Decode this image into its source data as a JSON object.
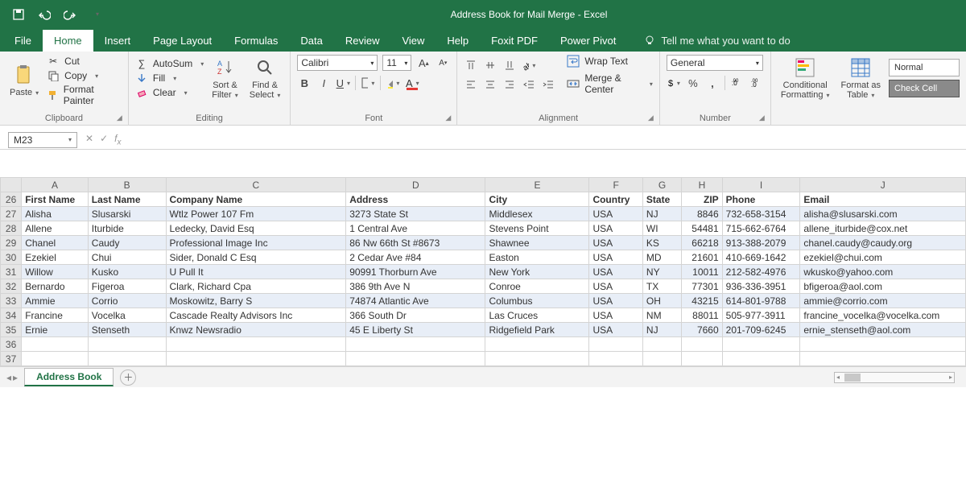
{
  "title": "Address Book for Mail Merge  -  Excel",
  "tabs": [
    "File",
    "Home",
    "Insert",
    "Page Layout",
    "Formulas",
    "Data",
    "Review",
    "View",
    "Help",
    "Foxit PDF",
    "Power Pivot"
  ],
  "tellme": "Tell me what you want to do",
  "clipboard": {
    "paste": "Paste",
    "cut": "Cut",
    "copy": "Copy",
    "fp": "Format Painter",
    "label": "Clipboard"
  },
  "editing": {
    "autosum": "AutoSum",
    "fill": "Fill",
    "clear": "Clear",
    "sort": "Sort &\nFilter",
    "find": "Find &\nSelect",
    "label": "Editing"
  },
  "font": {
    "name": "Calibri",
    "size": "11",
    "label": "Font"
  },
  "alignment": {
    "wrap": "Wrap Text",
    "merge": "Merge & Center",
    "label": "Alignment"
  },
  "number": {
    "fmt": "General",
    "label": "Number"
  },
  "styles": {
    "cf": "Conditional\nFormatting",
    "fat": "Format as\nTable",
    "normal": "Normal",
    "check": "Check Cell"
  },
  "namebox": "M23",
  "columns": [
    "A",
    "B",
    "C",
    "D",
    "E",
    "F",
    "G",
    "H",
    "I",
    "J"
  ],
  "header_row": 26,
  "headers": [
    "First Name",
    "Last Name",
    "Company Name",
    "Address",
    "City",
    "Country",
    "State",
    "ZIP",
    "Phone",
    "Email"
  ],
  "rows": [
    {
      "n": 27,
      "d": [
        "Alisha",
        "Slusarski",
        "Wtlz Power 107 Fm",
        "3273 State St",
        "Middlesex",
        "USA",
        "NJ",
        "8846",
        "732-658-3154",
        "alisha@slusarski.com"
      ]
    },
    {
      "n": 28,
      "d": [
        "Allene",
        "Iturbide",
        "Ledecky, David Esq",
        "1 Central Ave",
        "Stevens Point",
        "USA",
        "WI",
        "54481",
        "715-662-6764",
        "allene_iturbide@cox.net"
      ]
    },
    {
      "n": 29,
      "d": [
        "Chanel",
        "Caudy",
        "Professional Image Inc",
        "86 Nw 66th St #8673",
        "Shawnee",
        "USA",
        "KS",
        "66218",
        "913-388-2079",
        "chanel.caudy@caudy.org"
      ]
    },
    {
      "n": 30,
      "d": [
        "Ezekiel",
        "Chui",
        "Sider, Donald C Esq",
        "2 Cedar Ave #84",
        "Easton",
        "USA",
        "MD",
        "21601",
        "410-669-1642",
        "ezekiel@chui.com"
      ]
    },
    {
      "n": 31,
      "d": [
        "Willow",
        "Kusko",
        "U Pull It",
        "90991 Thorburn Ave",
        "New York",
        "USA",
        "NY",
        "10011",
        "212-582-4976",
        "wkusko@yahoo.com"
      ]
    },
    {
      "n": 32,
      "d": [
        "Bernardo",
        "Figeroa",
        "Clark, Richard Cpa",
        "386 9th Ave N",
        "Conroe",
        "USA",
        "TX",
        "77301",
        "936-336-3951",
        "bfigeroa@aol.com"
      ]
    },
    {
      "n": 33,
      "d": [
        "Ammie",
        "Corrio",
        "Moskowitz, Barry S",
        "74874 Atlantic Ave",
        "Columbus",
        "USA",
        "OH",
        "43215",
        "614-801-9788",
        "ammie@corrio.com"
      ]
    },
    {
      "n": 34,
      "d": [
        "Francine",
        "Vocelka",
        "Cascade Realty Advisors Inc",
        "366 South Dr",
        "Las Cruces",
        "USA",
        "NM",
        "88011",
        "505-977-3911",
        "francine_vocelka@vocelka.com"
      ]
    },
    {
      "n": 35,
      "d": [
        "Ernie",
        "Stenseth",
        "Knwz Newsradio",
        "45 E Liberty St",
        "Ridgefield Park",
        "USA",
        "NJ",
        "7660",
        "201-709-6245",
        "ernie_stenseth@aol.com"
      ]
    }
  ],
  "empty_rows": [
    36,
    37
  ],
  "sheet": "Address Book"
}
